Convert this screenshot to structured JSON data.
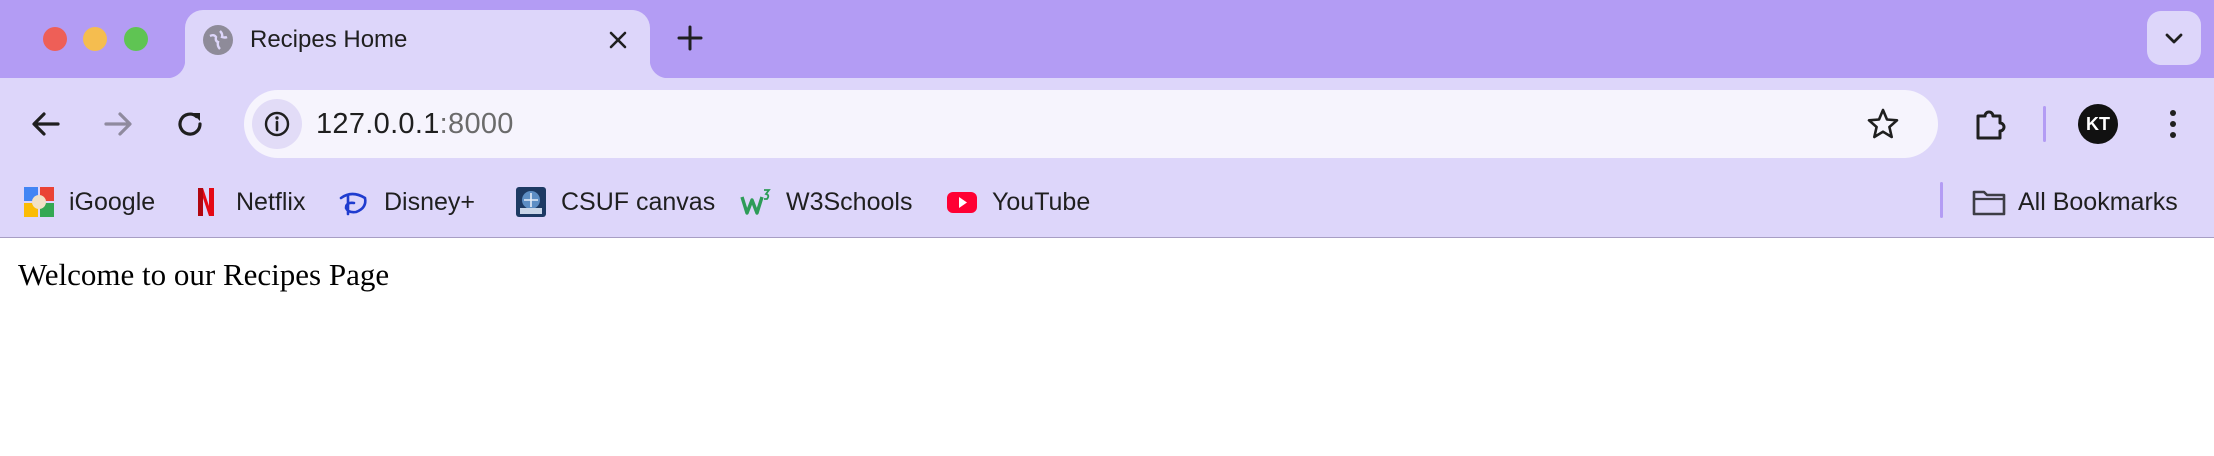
{
  "browser": {
    "tab": {
      "title": "Recipes Home",
      "favicon": "globe-icon",
      "close_icon": "close-icon"
    },
    "new_tab_icon": "plus-icon",
    "tab_menu_icon": "chevron-down-icon",
    "toolbar": {
      "back_icon": "arrow-left-icon",
      "forward_icon": "arrow-right-icon",
      "reload_icon": "reload-icon",
      "site_info_icon": "info-icon",
      "url_host": "127.0.0.1",
      "url_port": ":8000",
      "bookmark_star_icon": "star-icon",
      "extensions_icon": "puzzle-icon",
      "profile_initials": "KT",
      "menu_icon": "kebab-menu-icon"
    },
    "bookmarks": [
      {
        "label": "iGoogle",
        "icon": "igoogle-icon"
      },
      {
        "label": "Netflix",
        "icon": "netflix-icon"
      },
      {
        "label": "Disney+",
        "icon": "disney-icon"
      },
      {
        "label": "CSUF canvas",
        "icon": "csuf-icon"
      },
      {
        "label": "W3Schools",
        "icon": "w3schools-icon"
      },
      {
        "label": "YouTube",
        "icon": "youtube-icon"
      }
    ],
    "all_bookmarks": {
      "label": "All Bookmarks",
      "icon": "folder-icon"
    }
  },
  "page": {
    "heading": "Welcome to our Recipes Page"
  },
  "colors": {
    "titlebar": "#b39cf4",
    "toolbar": "#ddd6fa",
    "omnibox": "#f6f4fd"
  }
}
